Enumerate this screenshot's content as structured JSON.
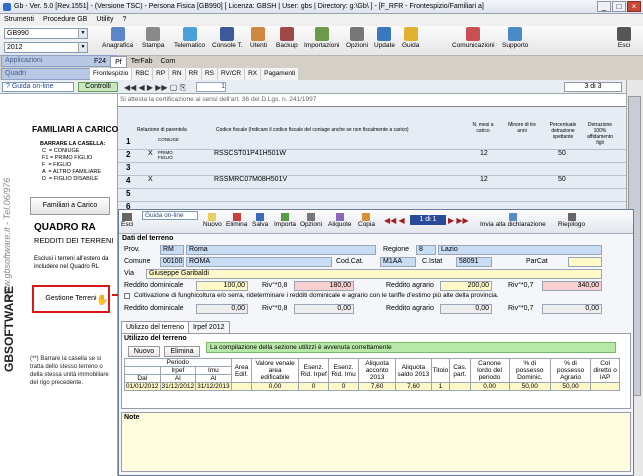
{
  "window": {
    "title": "Gb - Ver. 5.0 [Rev.1551] - (Versione TSC) - Persona Fisica [GB990]   [ Licenza: GBSH | User: gbs | Directory: g:\\Gb\\ ] - [F_RFR - Frontespizio/Familiari a]"
  },
  "menu": [
    "Strumenti",
    "Procedure GB",
    "Utility",
    "?"
  ],
  "ribbon": {
    "model": "GB990",
    "year": "2012",
    "dropdown1": "Applicazioni",
    "dropdown2": "Quadri",
    "tools": [
      "Anagrafica",
      "Stampa",
      "Telematico",
      "Console T.",
      "Utenti",
      "Backup",
      "Importazioni",
      "Opzioni",
      "Update",
      "Guida"
    ],
    "right_tools": [
      "Comunicazioni",
      "Supporto",
      "Esci"
    ]
  },
  "tabs_top": [
    "F24",
    "Pf",
    "TerFab",
    "Com"
  ],
  "tabs_bottom": [
    "Frontespizio",
    "RBC",
    "RP",
    "RN",
    "RR",
    "RS",
    "RV/CR",
    "RX",
    "Pagamenti"
  ],
  "nav": {
    "guide": "Guida on-line",
    "controls": "Controlli",
    "page": "1",
    "pages": "3 di 3"
  },
  "left": {
    "website": "www.gbsoftware.it - Tel.06/976",
    "familiari_title": "FAMILIARI A CARICO",
    "legend_title": "BARRARE LA CASELLA:",
    "legend": [
      "C  = CONIUGE",
      "F1 = PRIMO FIGLIO",
      "F  = FIGLIO",
      "A  = ALTRO FAMILIARE",
      "D  = FIGLIO DISABILE"
    ],
    "familiari_btn": "Familiari a Carico",
    "quadro_title": "QUADRO RA",
    "quadro_sub": "REDDITI DEI TERRENI",
    "quadro_note": "Esclusi i terreni all'estero da includere nel Quadro RL",
    "gestione_btn": "Gestione Terreni",
    "brand": "GBSOFTWARE",
    "footnote": "(**) Barrare la casella se si tratta dello stesso terreno o della stessa unità immobiliare del rigo precedente."
  },
  "main": {
    "cert_text": "Si attesta la certificazione ai sensi dell'art. 36 del D.Lgs. n. 241/1997",
    "fam_headers": [
      "Relazione di parentela",
      "Codice fiscale (Indicare il codice fiscale del coniuge anche se non fiscalmente a carico)",
      "N. mesi a carico",
      "Minore di tre anni",
      "Percentuale detrazione spettante",
      "Detrazione 100% affidamento figli"
    ],
    "fam_rows": [
      {
        "n": "1",
        "x": "",
        "rel": "CONIUGE",
        "cf": "",
        "mesi": "",
        "perc": ""
      },
      {
        "n": "2",
        "x": "X",
        "rel": "PRIMO FIGLIO",
        "cf": "RSSCST01P41H501W",
        "mesi": "12",
        "perc": "50"
      },
      {
        "n": "3",
        "x": "",
        "rel": "",
        "cf": "",
        "mesi": "",
        "perc": ""
      },
      {
        "n": "4",
        "x": "X",
        "rel": "",
        "cf": "RSSMRC07M08H501V",
        "mesi": "12",
        "perc": "50"
      },
      {
        "n": "5",
        "x": "",
        "rel": "",
        "cf": "",
        "mesi": "",
        "perc": ""
      },
      {
        "n": "6",
        "x": "",
        "rel": "",
        "cf": "",
        "mesi": "",
        "perc": ""
      }
    ]
  },
  "dialog": {
    "tools": [
      "Esci",
      "Guida on-line",
      "Nuovo",
      "Elimina",
      "Salva",
      "Importa",
      "Opzioni",
      "Aliquote",
      "Copia"
    ],
    "page": "1 di 1",
    "extra": [
      "Invia alla dichiarazione",
      "Riepilogo"
    ],
    "section": "Dati del terreno",
    "prov_lbl": "Prov.",
    "prov": "RM",
    "prov_name": "Roma",
    "regione_lbl": "Regione",
    "regione_code": "8",
    "regione": "Lazio",
    "comune_lbl": "Comune",
    "comune_code": "00100",
    "comune": "ROMA",
    "codcat_lbl": "Cod.Cat.",
    "codcat": "M1AA",
    "cistat_lbl": "C.Istat",
    "cistat": "58091",
    "parcat_lbl": "ParCat",
    "via_lbl": "Via",
    "via": "Giuseppe Garibaldi",
    "rd_lbl": "Reddito dominicale",
    "rd": "100,00",
    "riv_lbl": "Riv°*0,8",
    "rd_riv": "180,00",
    "ra_lbl": "Reddito agrario",
    "ra": "200,00",
    "riv2_lbl": "Riv°*0,7",
    "ra_riv": "340,00",
    "check_text": "Coltivazione di funghicoltura e/o serra, rideterminare i redditi dominicale e agrario con le tariffe d'estimo più alte della provincia.",
    "rd2": "0,00",
    "rd2_riv": "0,00",
    "ra2": "0,00",
    "ra2_riv": "0,00",
    "tabs": [
      "Utilizzo del terreno",
      "Irpef 2012"
    ],
    "util_title": "Utilizzo del terreno",
    "new_btn": "Nuovo",
    "del_btn": "Elimina",
    "status": "La compilazione della sezione utilizzi è avvenuta correttamente",
    "grid_headers": [
      "Periodo",
      "Irpef",
      "Imu",
      "Dal",
      "Al",
      "Al",
      "Area Edif.",
      "Valore venale area edificabile",
      "Esenz. Rid. Irpef",
      "Esenz. Rid. Imu",
      "Aliquota acconto 2013",
      "Aliquota saldo 2013",
      "Titolo",
      "Cas. part.",
      "Canone lordo del periodo",
      "% di possesso Dominic.",
      "% di possesso Agrario",
      "Col diretto o IAP"
    ],
    "grid_row": [
      "01/01/2012",
      "31/12/2012",
      "31/12/2013",
      "",
      "0,00",
      "0",
      "0",
      "7,60",
      "7,60",
      "1",
      "",
      "0,00",
      "50,00",
      "50,00",
      ""
    ],
    "note_lbl": "Note"
  }
}
